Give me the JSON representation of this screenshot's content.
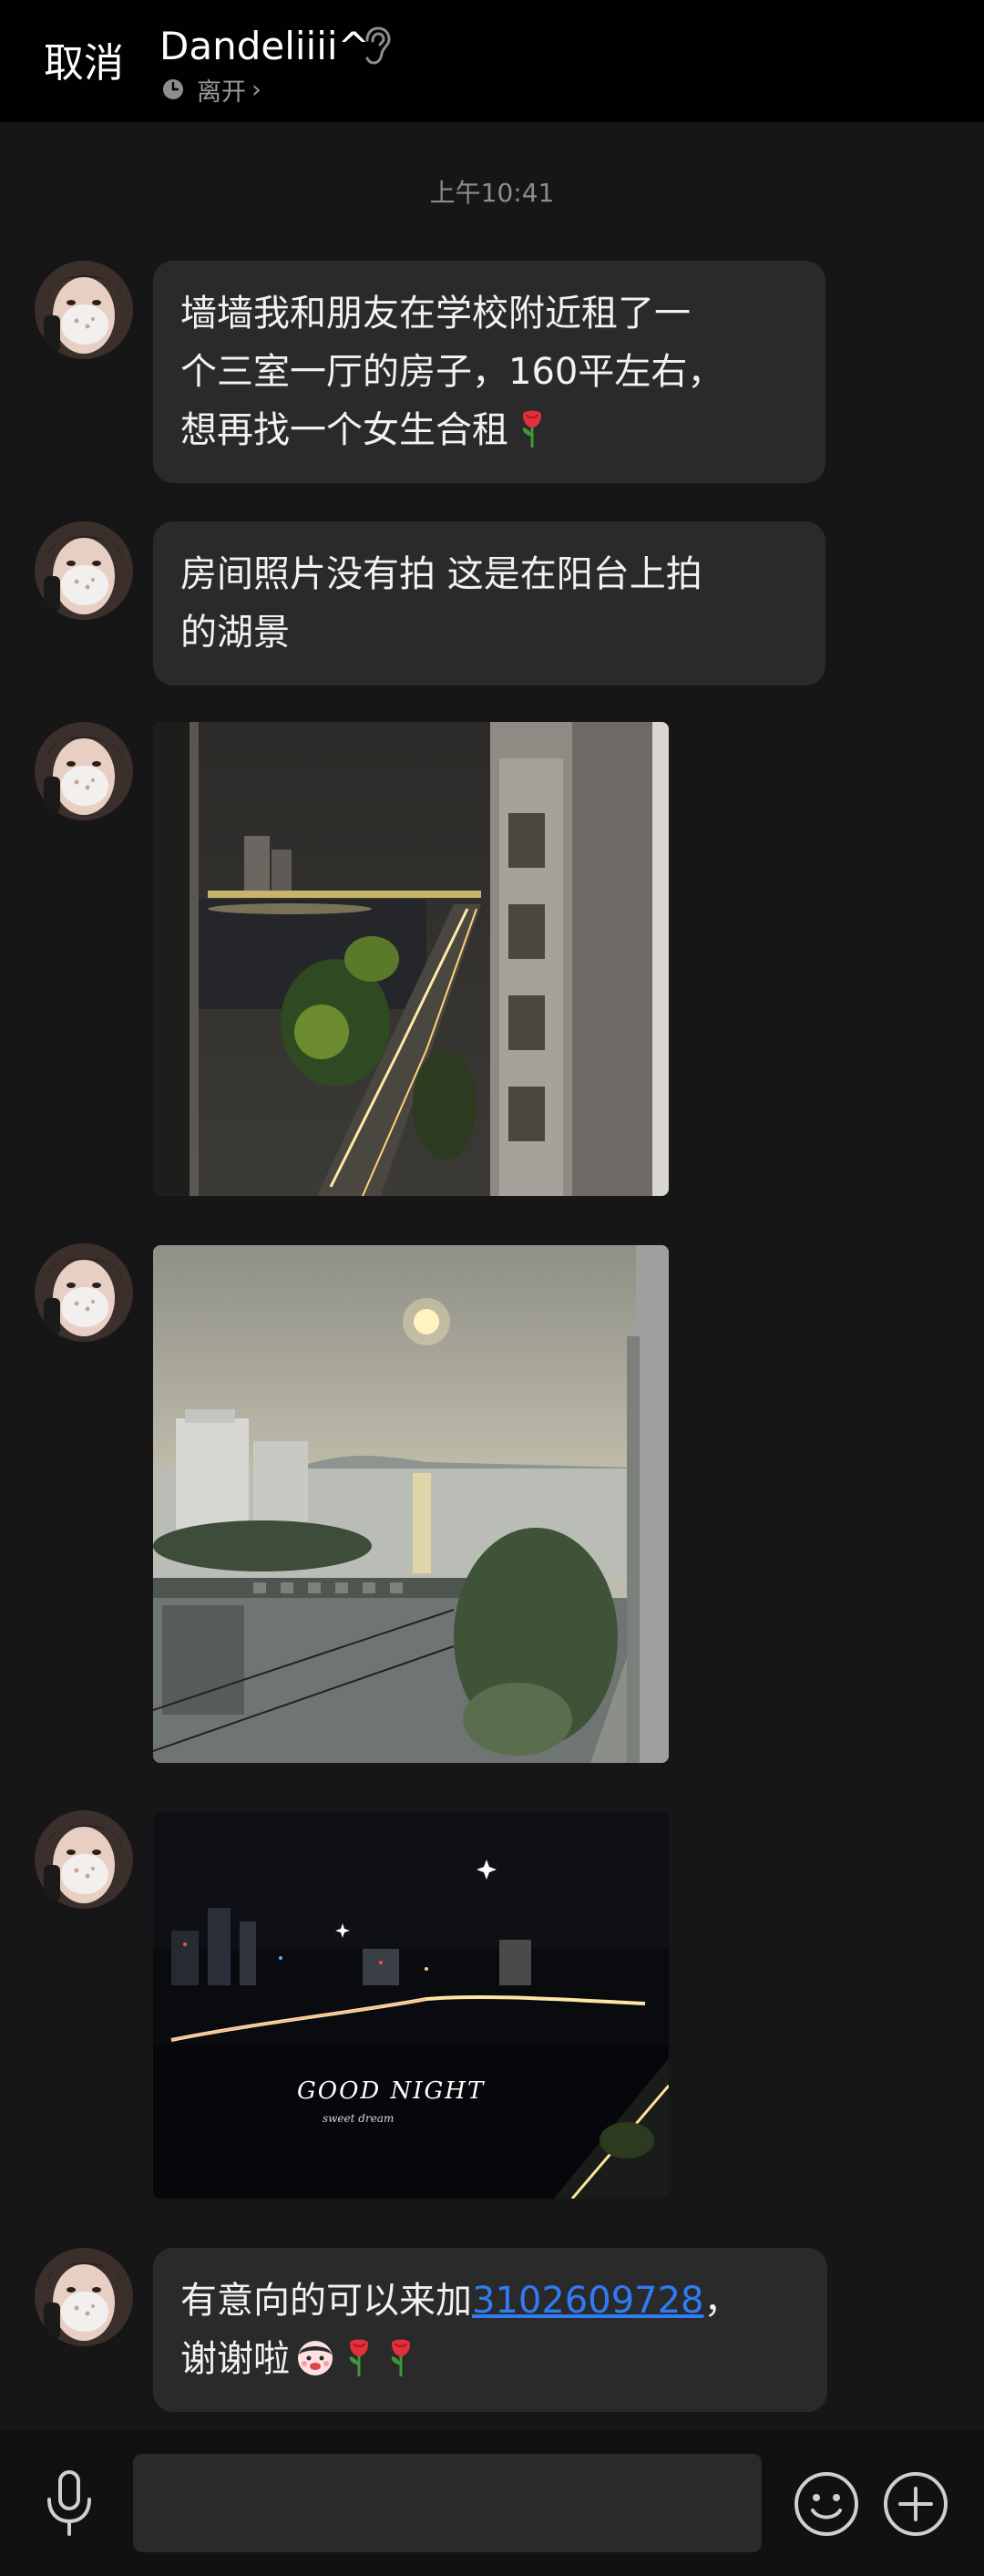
{
  "header": {
    "cancel_label": "取消",
    "contact_name": "Dandeliiii^",
    "status_text": "离开",
    "status_chevron": "›",
    "icons": [
      "ear-icon",
      "status-clock-icon"
    ]
  },
  "chat": {
    "timestamp": "上午10:41",
    "messages": [
      {
        "type": "text",
        "lines": [
          "墙墙我和朋友在学校附近租了一",
          "个三室一厅的房子，160平左右，",
          "想再找一个女生合租"
        ],
        "emoji": "rose-icon"
      },
      {
        "type": "text",
        "lines": [
          "房间照片没有拍 这是在阳台上拍",
          "的湖景"
        ]
      },
      {
        "type": "image",
        "subject": "night-street-view-photo"
      },
      {
        "type": "image",
        "subject": "lake-sunset-photo"
      },
      {
        "type": "image",
        "subject": "night-lake-photo",
        "overlay_title": "GOOD NIGHT",
        "overlay_subtitle": "sweet dream"
      },
      {
        "type": "text",
        "line1_prefix": "有意向的可以来加",
        "phone": "3102609728",
        "line1_suffix": "，",
        "line2": "谢谢啦",
        "emojis": [
          "face-emoji-icon",
          "rose-icon",
          "rose-icon"
        ]
      }
    ]
  },
  "input_bar": {
    "placeholder": "",
    "icons": [
      "microphone-icon",
      "emoji-icon",
      "plus-icon"
    ]
  },
  "colors": {
    "background": "#161616",
    "header": "#010101",
    "bubble": "#2a2a2a",
    "link": "#2f7cf4"
  }
}
